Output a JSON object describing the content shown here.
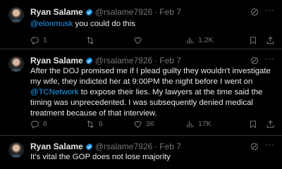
{
  "tweets": [
    {
      "name": "Ryan Salame",
      "handle": "@rsalame7926",
      "sep": "·",
      "date": "Feb 7",
      "text_parts": [
        "@elonmusk",
        " you could do this"
      ],
      "stats": {
        "replies": "1",
        "retweets": "",
        "likes": "",
        "views": "1.2K"
      }
    },
    {
      "name": "Ryan Salame",
      "handle": "@rsalame7926",
      "sep": "·",
      "date": "Feb 7",
      "text_parts": [
        "After the DOJ promised me if I plead guilty they wouldn't investigate my wife, they indicted her at 9:00PM the night before I went on ",
        "@TCNetwork",
        " to expose their lies. My lawyers at the time said the timing was unprecedented. I was subsequently denied medical treatment because of that interview."
      ],
      "stats": {
        "replies": "6",
        "retweets": "6",
        "likes": "36",
        "views": "17K"
      }
    },
    {
      "name": "Ryan Salame",
      "handle": "@rsalame7926",
      "sep": "·",
      "date": "Feb 7",
      "text_parts": [
        "It's vital the GOP does not lose majority"
      ],
      "stats": {}
    }
  ],
  "icons": {
    "verified": "verified-badge-icon",
    "grok": "grok-icon",
    "more": "more-icon",
    "reply": "reply-icon",
    "retweet": "retweet-icon",
    "like": "like-icon",
    "views": "views-icon",
    "bookmark": "bookmark-icon",
    "share": "share-icon"
  },
  "colors": {
    "background": "#000000",
    "text": "#e7e9ea",
    "muted": "#71767b",
    "accent": "#1d9bf0",
    "divider": "#2f3336"
  }
}
